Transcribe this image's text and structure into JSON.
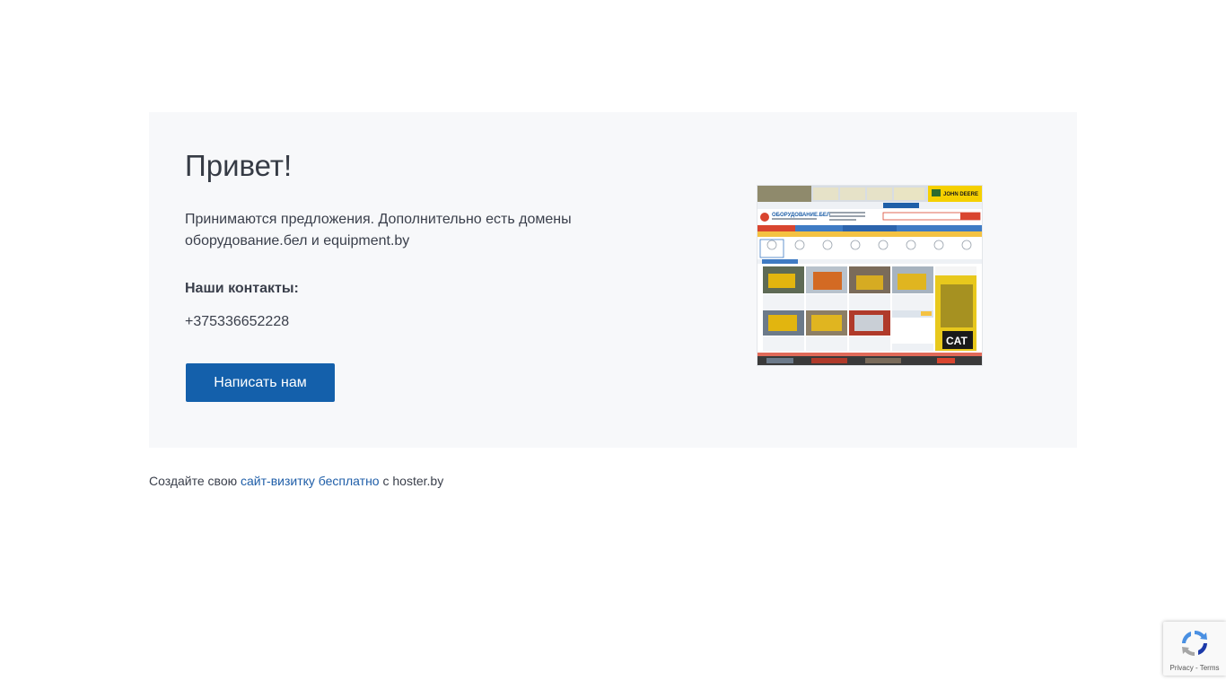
{
  "card": {
    "title": "Привет!",
    "description": "Принимаются предложения. Дополнительно есть домены оборудование.бел и equipment.by",
    "contacts_heading": "Наши контакты:",
    "phone": "+375336652228",
    "button_label": "Написать нам"
  },
  "preview": {
    "site_name": "ОБОРУДОВАНИЕ.БЕЛ",
    "banner_brand": "JOHN DEERE",
    "ad_brand": "CAT"
  },
  "footer": {
    "prefix": "Создайте свою",
    "link_text": "сайт-визитку бесплатно",
    "suffix": "с hoster.by"
  },
  "recaptcha": {
    "privacy": "Privacy",
    "separator": "-",
    "terms": "Terms"
  },
  "colors": {
    "accent": "#1460ab",
    "link": "#1f5ea8",
    "card_bg": "#f7f8fa",
    "text": "#3a3f4b"
  }
}
